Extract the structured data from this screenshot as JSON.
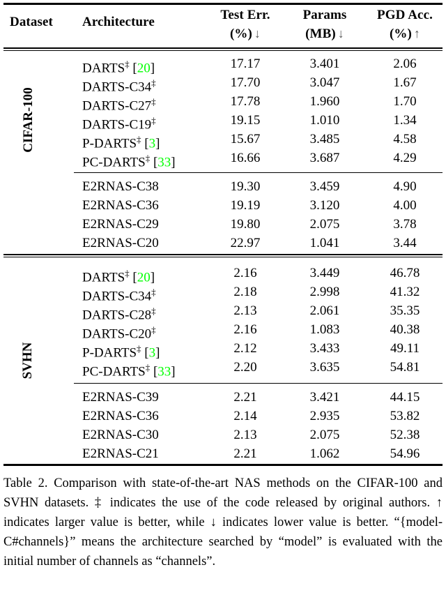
{
  "table": {
    "header": {
      "dataset": "Dataset",
      "architecture": "Architecture",
      "columns": [
        {
          "line1": "Test Err.",
          "line2": "(%)",
          "arrow": "↓"
        },
        {
          "line1": "Params",
          "line2": "(MB)",
          "arrow": "↓"
        },
        {
          "line1": "PGD Acc.",
          "line2": "(%)",
          "arrow": "↑"
        }
      ]
    },
    "column_headers": [
      "Dataset",
      "Architecture",
      "Test Err. (%) ↓",
      "Params (MB) ↓",
      "PGD Acc. (%) ↑"
    ],
    "groups": [
      {
        "dataset": "CIFAR-100",
        "subgroups": [
          {
            "rows": [
              {
                "architecture": "DARTS",
                "dagger": "‡",
                "cite": "20",
                "test_err": "17.17",
                "params": "3.401",
                "pgd_acc": "2.06"
              },
              {
                "architecture": "DARTS-C34",
                "dagger": "‡",
                "cite": "",
                "test_err": "17.70",
                "params": "3.047",
                "pgd_acc": "1.67"
              },
              {
                "architecture": "DARTS-C27",
                "dagger": "‡",
                "cite": "",
                "test_err": "17.78",
                "params": "1.960",
                "pgd_acc": "1.70"
              },
              {
                "architecture": "DARTS-C19",
                "dagger": "‡",
                "cite": "",
                "test_err": "19.15",
                "params": "1.010",
                "pgd_acc": "1.34"
              },
              {
                "architecture": "P-DARTS",
                "dagger": "‡",
                "cite": "3",
                "test_err": "15.67",
                "params": "3.485",
                "pgd_acc": "4.58"
              },
              {
                "architecture": "PC-DARTS",
                "dagger": "‡",
                "cite": "33",
                "test_err": "16.66",
                "params": "3.687",
                "pgd_acc": "4.29"
              }
            ]
          },
          {
            "rows": [
              {
                "architecture": "E2RNAS-C38",
                "dagger": "",
                "cite": "",
                "test_err": "19.30",
                "params": "3.459",
                "pgd_acc": "4.90"
              },
              {
                "architecture": "E2RNAS-C36",
                "dagger": "",
                "cite": "",
                "test_err": "19.19",
                "params": "3.120",
                "pgd_acc": "4.00"
              },
              {
                "architecture": "E2RNAS-C29",
                "dagger": "",
                "cite": "",
                "test_err": "19.80",
                "params": "2.075",
                "pgd_acc": "3.78"
              },
              {
                "architecture": "E2RNAS-C20",
                "dagger": "",
                "cite": "",
                "test_err": "22.97",
                "params": "1.041",
                "pgd_acc": "3.44"
              }
            ]
          }
        ]
      },
      {
        "dataset": "SVHN",
        "subgroups": [
          {
            "rows": [
              {
                "architecture": "DARTS",
                "dagger": "‡",
                "cite": "20",
                "test_err": "2.16",
                "params": "3.449",
                "pgd_acc": "46.78"
              },
              {
                "architecture": "DARTS-C34",
                "dagger": "‡",
                "cite": "",
                "test_err": "2.18",
                "params": "2.998",
                "pgd_acc": "41.32"
              },
              {
                "architecture": "DARTS-C28",
                "dagger": "‡",
                "cite": "",
                "test_err": "2.13",
                "params": "2.061",
                "pgd_acc": "35.35"
              },
              {
                "architecture": "DARTS-C20",
                "dagger": "‡",
                "cite": "",
                "test_err": "2.16",
                "params": "1.083",
                "pgd_acc": "40.38"
              },
              {
                "architecture": "P-DARTS",
                "dagger": "‡",
                "cite": "3",
                "test_err": "2.12",
                "params": "3.433",
                "pgd_acc": "49.11"
              },
              {
                "architecture": "PC-DARTS",
                "dagger": "‡",
                "cite": "33",
                "test_err": "2.20",
                "params": "3.635",
                "pgd_acc": "54.81"
              }
            ]
          },
          {
            "rows": [
              {
                "architecture": "E2RNAS-C39",
                "dagger": "",
                "cite": "",
                "test_err": "2.21",
                "params": "3.421",
                "pgd_acc": "44.15"
              },
              {
                "architecture": "E2RNAS-C36",
                "dagger": "",
                "cite": "",
                "test_err": "2.14",
                "params": "2.935",
                "pgd_acc": "53.82"
              },
              {
                "architecture": "E2RNAS-C30",
                "dagger": "",
                "cite": "",
                "test_err": "2.13",
                "params": "2.075",
                "pgd_acc": "52.38"
              },
              {
                "architecture": "E2RNAS-C21",
                "dagger": "",
                "cite": "",
                "test_err": "2.21",
                "params": "1.062",
                "pgd_acc": "54.96"
              }
            ]
          }
        ]
      }
    ]
  },
  "caption": {
    "label": "Table 2.",
    "text": "Comparison with state-of-the-art NAS methods on the CIFAR-100 and SVHN datasets. ‡ indicates the use of the code released by original authors. ↑ indicates larger value is better, while ↓ indicates lower value is better. “{model-C#channels}” means the architecture searched by “model” is evaluated with the initial number of channels as “channels”.",
    "full": "Table 2. Comparison with state-of-the-art NAS methods on the CIFAR-100 and SVHN datasets. ‡ indicates the use of the code released by original authors. ↑ indicates larger value is better, while ↓ indicates lower value is better. “{model-C#channels}” means the architecture searched by “model” is evaluated with the initial number of channels as “channels”."
  },
  "colors": {
    "citation_green": "#00ff00",
    "text": "#000000",
    "background": "#ffffff",
    "arrow_gray": "#555555"
  }
}
